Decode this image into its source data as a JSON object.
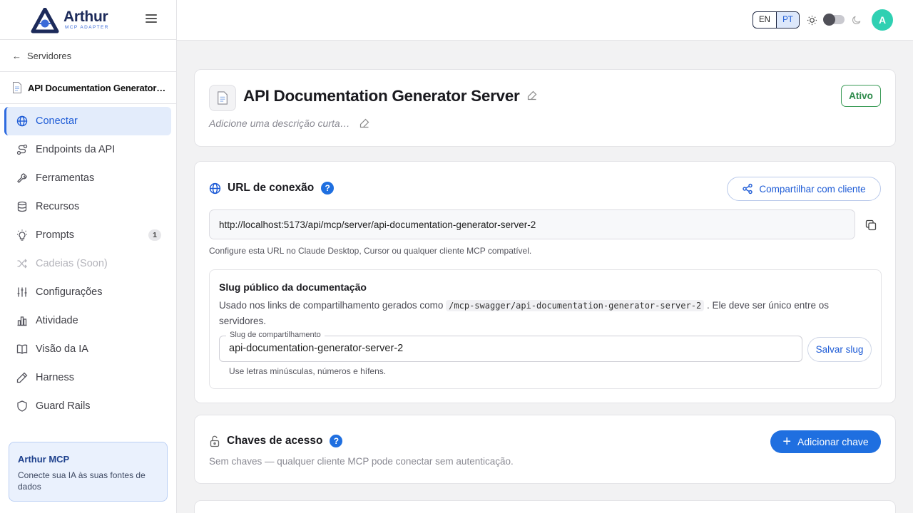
{
  "brand": {
    "name": "Arthur",
    "subtitle": "MCP ADAPTER"
  },
  "sidebar": {
    "back_label": "Servidores",
    "server_name": "API Documentation Generator Server",
    "items": [
      {
        "label": "Conectar",
        "icon": "globe-icon",
        "active": true
      },
      {
        "label": "Endpoints da API",
        "icon": "route-icon"
      },
      {
        "label": "Ferramentas",
        "icon": "wrench-icon"
      },
      {
        "label": "Recursos",
        "icon": "database-icon"
      },
      {
        "label": "Prompts",
        "icon": "lightbulb-icon",
        "badge": "1"
      },
      {
        "label": "Cadeias (Soon)",
        "icon": "shuffle-icon",
        "disabled": true
      },
      {
        "label": "Configurações",
        "icon": "sliders-icon"
      },
      {
        "label": "Atividade",
        "icon": "bar-chart-icon"
      },
      {
        "label": "Visão da IA",
        "icon": "book-open-icon"
      },
      {
        "label": "Harness",
        "icon": "pencil-ruler-icon"
      },
      {
        "label": "Guard Rails",
        "icon": "shield-icon"
      }
    ],
    "promo": {
      "title": "Arthur MCP",
      "desc": "Conecte sua IA às suas fontes de dados"
    }
  },
  "topbar": {
    "lang_en": "EN",
    "lang_pt": "PT",
    "avatar_letter": "A"
  },
  "header": {
    "title": "API Documentation Generator Server",
    "description_placeholder": "Adicione uma descrição curta…",
    "status": "Ativo"
  },
  "connection": {
    "title": "URL de conexão",
    "share_label": "Compartilhar com cliente",
    "url": "http://localhost:5173/api/mcp/server/api-documentation-generator-server-2",
    "hint": "Configure esta URL no Claude Desktop, Cursor ou qualquer cliente MCP compatível.",
    "slug": {
      "title": "Slug público da documentação",
      "desc_before": "Usado nos links de compartilhamento gerados como ",
      "desc_code": "/mcp-swagger/api-documentation-generator-server-2",
      "desc_after": " . Ele deve ser único entre os servidores.",
      "field_label": "Slug de compartilhamento",
      "field_value": "api-documentation-generator-server-2",
      "save_label": "Salvar slug",
      "hint": "Use letras minúsculas, números e hífens."
    }
  },
  "keys": {
    "title": "Chaves de acesso",
    "add_label": "Adicionar chave",
    "empty": "Sem chaves — qualquer cliente MCP pode conectar sem autenticação."
  },
  "colors": {
    "accent": "#1f6fe0",
    "active_bg": "#e3ecfb",
    "status_green": "#2e8a4b",
    "avatar": "#2fd0b2"
  }
}
